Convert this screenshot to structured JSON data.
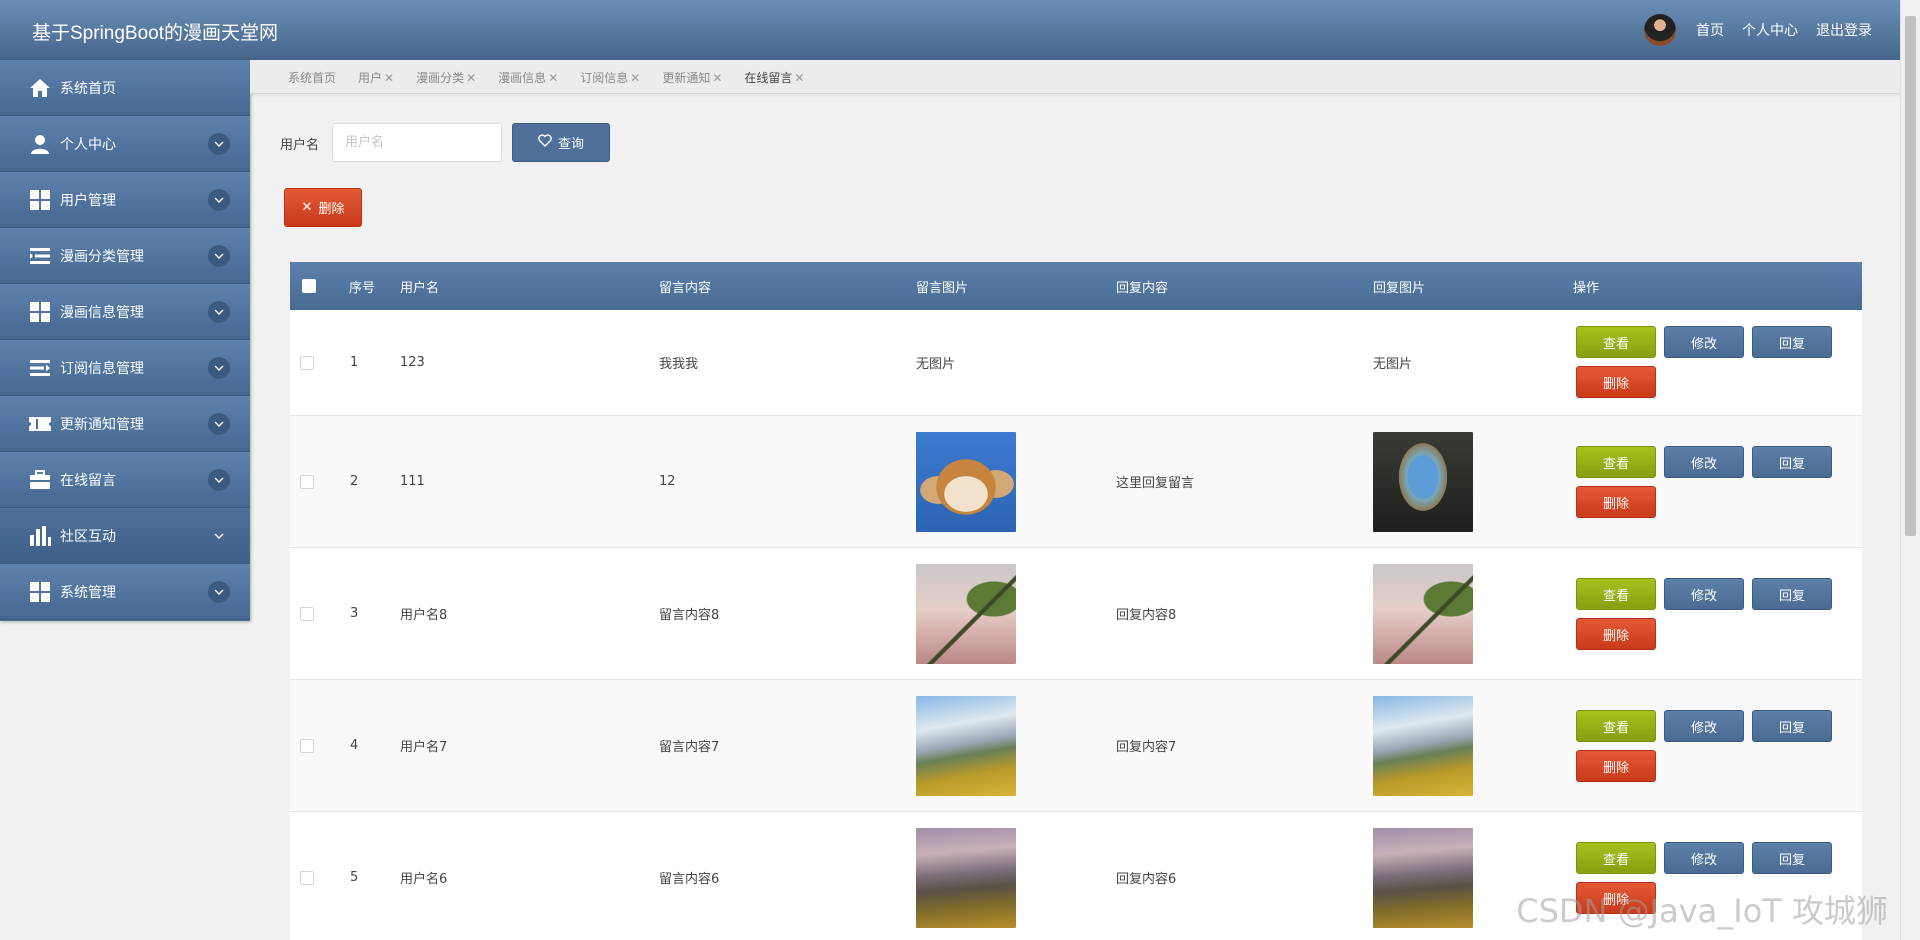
{
  "app": {
    "title": "基于SpringBoot的漫画天堂网"
  },
  "topnav": {
    "home": "首页",
    "profile": "个人中心",
    "logout": "退出登录"
  },
  "sidebar": {
    "items": [
      {
        "label": "系统首页",
        "icon": "home-icon"
      },
      {
        "label": "个人中心",
        "icon": "user-icon"
      },
      {
        "label": "用户管理",
        "icon": "grid-icon"
      },
      {
        "label": "漫画分类管理",
        "icon": "list-icon"
      },
      {
        "label": "漫画信息管理",
        "icon": "grid-icon"
      },
      {
        "label": "订阅信息管理",
        "icon": "list-arrow-icon"
      },
      {
        "label": "更新通知管理",
        "icon": "ticket-icon"
      },
      {
        "label": "在线留言",
        "icon": "briefcase-icon"
      },
      {
        "label": "社区互动",
        "icon": "bar-chart-icon"
      },
      {
        "label": "系统管理",
        "icon": "grid-icon"
      }
    ]
  },
  "tabs": [
    {
      "label": "系统首页",
      "closable": false
    },
    {
      "label": "用户",
      "closable": true
    },
    {
      "label": "漫画分类",
      "closable": true
    },
    {
      "label": "漫画信息",
      "closable": true
    },
    {
      "label": "订阅信息",
      "closable": true
    },
    {
      "label": "更新通知",
      "closable": true
    },
    {
      "label": "在线留言",
      "closable": true
    }
  ],
  "search": {
    "label": "用户名",
    "placeholder": "用户名",
    "value": "",
    "button": "查询"
  },
  "toolbar": {
    "delete": "删除"
  },
  "table": {
    "headers": [
      "序号",
      "用户名",
      "留言内容",
      "留言图片",
      "回复内容",
      "回复图片",
      "操作"
    ],
    "rows": [
      {
        "no": "1",
        "username": "123",
        "content": "我我我",
        "image_text": "无图片",
        "reply": "",
        "reply_image_text": "无图片"
      },
      {
        "no": "2",
        "username": "111",
        "content": "12",
        "reply": "这里回复留言"
      },
      {
        "no": "3",
        "username": "用户名8",
        "content": "留言内容8",
        "reply": "回复内容8"
      },
      {
        "no": "4",
        "username": "用户名7",
        "content": "留言内容7",
        "reply": "回复内容7"
      },
      {
        "no": "5",
        "username": "用户名6",
        "content": "留言内容6",
        "reply": "回复内容6"
      }
    ],
    "actions": {
      "view": "查看",
      "edit": "修改",
      "reply": "回复",
      "delete": "删除"
    }
  },
  "watermark": "CSDN @Java_IoT 攻城狮",
  "colors": {
    "header": "#4f719a",
    "view": "#9ab515",
    "edit": "#4f709a",
    "delete": "#d6431f"
  }
}
